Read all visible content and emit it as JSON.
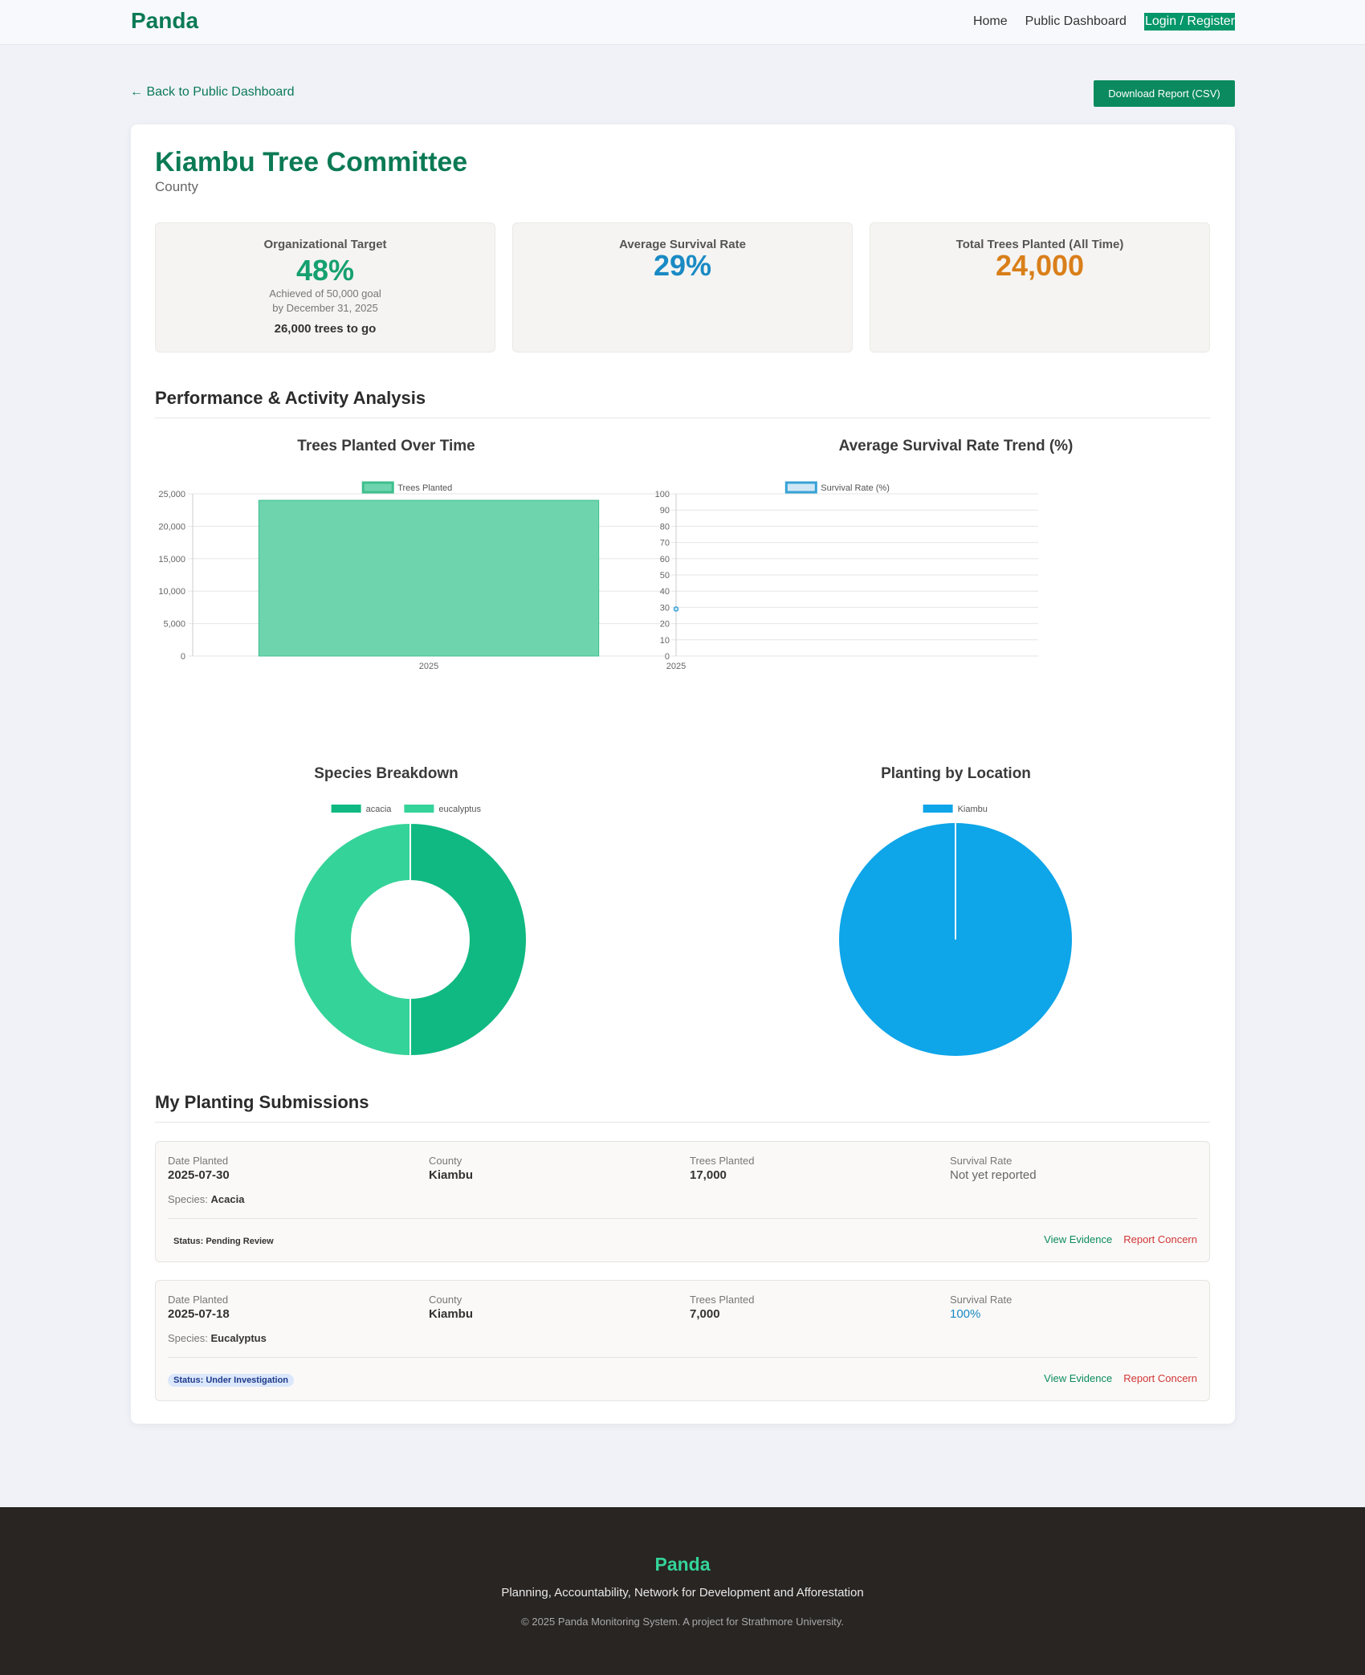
{
  "nav": {
    "brand": "Panda",
    "links": [
      "Home",
      "Public Dashboard"
    ],
    "login_label": "Login / Register"
  },
  "back_link": "← Back to Public Dashboard",
  "download_label": "Download Report (CSV)",
  "org": {
    "name": "Kiambu Tree Committee",
    "type": "County"
  },
  "stats": {
    "target": {
      "label": "Organizational Target",
      "value": "48%",
      "sub1": "Achieved of 50,000 goal",
      "sub2": "by December 31, 2025",
      "togo": "26,000 trees to go",
      "color": "#16a070"
    },
    "survival": {
      "label": "Average Survival Rate",
      "value": "29%",
      "color": "#1a8ac4"
    },
    "total": {
      "label": "Total Trees Planted (All Time)",
      "value": "24,000",
      "color": "#d97f1a"
    }
  },
  "section_perf": "Performance & Activity Analysis",
  "section_subs": "My Planting Submissions",
  "chart_data": [
    {
      "type": "bar",
      "title": "Trees Planted Over Time",
      "categories": [
        "2025"
      ],
      "series": [
        {
          "name": "Trees Planted",
          "values": [
            24000
          ],
          "color": "#6ed4ae"
        }
      ],
      "ylim": [
        0,
        25000
      ],
      "yticks": [
        "0",
        "5,000",
        "10,000",
        "15,000",
        "20,000",
        "25,000"
      ],
      "legend": "top-center",
      "grid": true
    },
    {
      "type": "line",
      "title": "Average Survival Rate Trend (%)",
      "categories": [
        "2025"
      ],
      "series": [
        {
          "name": "Survival Rate (%)",
          "values": [
            29
          ],
          "color": "#36a2d6"
        }
      ],
      "ylim": [
        0,
        100
      ],
      "yticks": [
        "0",
        "10",
        "20",
        "30",
        "40",
        "50",
        "60",
        "70",
        "80",
        "90",
        "100"
      ],
      "legend": "top-center",
      "grid": true
    },
    {
      "type": "pie",
      "title": "Species Breakdown",
      "donut": true,
      "labels": [
        "acacia",
        "eucalyptus"
      ],
      "values": [
        50,
        50
      ],
      "colors": [
        "#10b981",
        "#34d399"
      ],
      "legend": "top-center"
    },
    {
      "type": "pie",
      "title": "Planting by Location",
      "labels": [
        "Kiambu"
      ],
      "values": [
        100
      ],
      "colors": [
        "#0ea5e9"
      ],
      "legend": "top-center"
    }
  ],
  "submission_labels": {
    "date": "Date Planted",
    "county": "County",
    "trees": "Trees Planted",
    "survival": "Survival Rate",
    "species": "Species:",
    "view": "View Evidence",
    "concern": "Report Concern"
  },
  "submissions": [
    {
      "date": "2025-07-30",
      "county": "Kiambu",
      "trees": "17,000",
      "survival": "Not yet reported",
      "species": "Acacia",
      "status": "Status: Pending Review"
    },
    {
      "date": "2025-07-18",
      "county": "Kiambu",
      "trees": "7,000",
      "survival": "100%",
      "species": "Eucalyptus",
      "status": "Status: Under Investigation"
    }
  ],
  "footer": {
    "brand": "Panda",
    "tagline": "Planning, Accountability, Network for Development and Afforestation",
    "copyright": "© 2025 Panda Monitoring System. A project for Strathmore University."
  }
}
